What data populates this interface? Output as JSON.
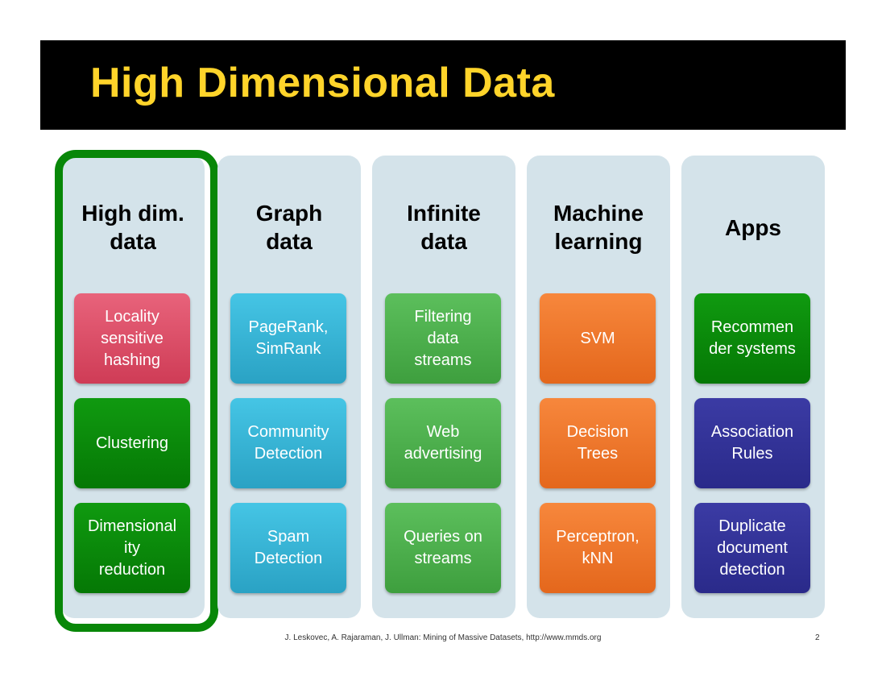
{
  "title": "High Dimensional Data",
  "columns": [
    {
      "heading": "High dim.\ndata",
      "highlighted": true,
      "items": [
        {
          "label": "Locality\nsensitive\nhashing",
          "color": "#d94a63"
        },
        {
          "label": "Clustering",
          "color": "#068a06"
        },
        {
          "label": "Dimensional\nity\nreduction",
          "color": "#068a06"
        }
      ]
    },
    {
      "heading": "Graph\ndata",
      "items": [
        {
          "label": "PageRank,\nSimRank",
          "color": "#35b3d6"
        },
        {
          "label": "Community\nDetection",
          "color": "#35b3d6"
        },
        {
          "label": "Spam\nDetection",
          "color": "#35b3d6"
        }
      ]
    },
    {
      "heading": "Infinite\ndata",
      "items": [
        {
          "label": "Filtering\ndata\nstreams",
          "color": "#4caf4c"
        },
        {
          "label": "Web\nadvertising",
          "color": "#4caf4c"
        },
        {
          "label": "Queries on\nstreams",
          "color": "#4caf4c"
        }
      ]
    },
    {
      "heading": "Machine\nlearning",
      "items": [
        {
          "label": "SVM",
          "color": "#ee7528"
        },
        {
          "label": "Decision\nTrees",
          "color": "#ee7528"
        },
        {
          "label": "Perceptron,\nkNN",
          "color": "#ee7528"
        }
      ]
    },
    {
      "heading": "Apps",
      "items": [
        {
          "label": "Recommen\nder systems",
          "color": "#068a06"
        },
        {
          "label": "Association\nRules",
          "color": "#333399"
        },
        {
          "label": "Duplicate\ndocument\ndetection",
          "color": "#333399"
        }
      ]
    }
  ],
  "footer": "J. Leskovec, A. Rajaraman, J. Ullman: Mining of Massive Datasets, http://www.mmds.org",
  "page_number": "2",
  "colors": {
    "title_text": "#ffd42a",
    "title_bar": "#000000",
    "column_bg": "#d4e3ea",
    "highlight_frame": "#088708"
  }
}
